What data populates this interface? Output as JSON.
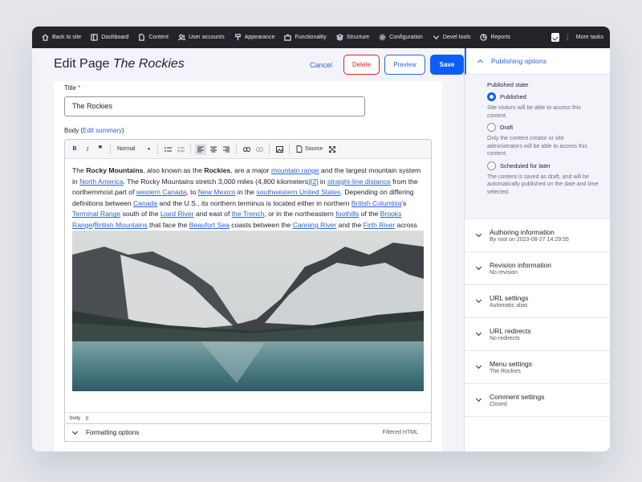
{
  "toolbar": {
    "items": [
      {
        "label": "Back to site",
        "icon": "home-icon"
      },
      {
        "label": "Dashboard",
        "icon": "dashboard-icon"
      },
      {
        "label": "Content",
        "icon": "file-icon"
      },
      {
        "label": "User accounts",
        "icon": "users-icon"
      },
      {
        "label": "Appearance",
        "icon": "brush-icon"
      },
      {
        "label": "Functionality",
        "icon": "puzzle-icon"
      },
      {
        "label": "Structure",
        "icon": "layers-icon"
      },
      {
        "label": "Configuration",
        "icon": "gear-icon"
      },
      {
        "label": "Devel tools",
        "icon": "chevron-icon"
      },
      {
        "label": "Reports",
        "icon": "chart-icon"
      }
    ],
    "more_tasks": "More tasks"
  },
  "header": {
    "title_prefix": "Edit Page",
    "title_italic": "The Rockies",
    "cancel": "Cancel",
    "delete": "Delete",
    "preview": "Preview",
    "save": "Save"
  },
  "form": {
    "title_label": "Title",
    "required_mark": "*",
    "title_value": "The Rockies",
    "body_label": "Body (",
    "edit_summary": "Edit summary",
    "body_label_end": ")"
  },
  "editor": {
    "format_select": "Normal",
    "source_label": "Source",
    "status_path": [
      "body",
      "p"
    ],
    "formatting_options": "Formatting options",
    "filtered_html": "Filtered HTML"
  },
  "sidebar": {
    "publishing_title": "Publishing options",
    "published_state": "Published state",
    "options": [
      {
        "label": "Published",
        "checked": true,
        "help": "Site visitors will be able to access this content."
      },
      {
        "label": "Draft",
        "checked": false,
        "help": "Only the content creator or site administrators will be able to access this content."
      },
      {
        "label": "Scheduled for later",
        "checked": false,
        "help": "The content is saved as draft, and will be automatically published on the date and time selected."
      }
    ],
    "sections": [
      {
        "title": "Authoring information",
        "summary": "By root on 2023-08-27 14:29:55"
      },
      {
        "title": "Revision information",
        "summary": "No revision"
      },
      {
        "title": "URL settings",
        "summary": "Automatic alias"
      },
      {
        "title": "URL redirects",
        "summary": "No redirects"
      },
      {
        "title": "Menu settings",
        "summary": "The Rockies"
      },
      {
        "title": "Comment settings",
        "summary": "Closed"
      }
    ]
  },
  "colors": {
    "accent": "#0b5ef7",
    "danger": "#d72222",
    "toolbar_bg": "#232429"
  }
}
